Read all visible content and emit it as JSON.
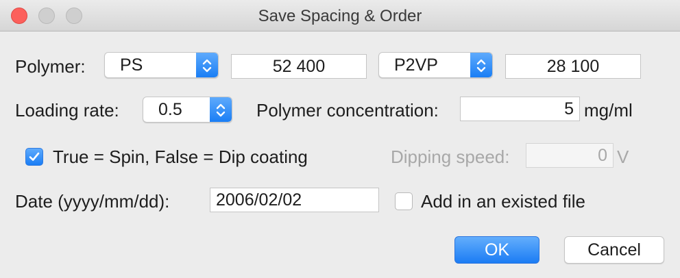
{
  "window": {
    "title": "Save Spacing & Order"
  },
  "polymer": {
    "label": "Polymer:",
    "select1": "PS",
    "value1": "52 400",
    "select2": "P2VP",
    "value2": "28 100"
  },
  "loading": {
    "label": "Loading rate:",
    "value": "0.5"
  },
  "concentration": {
    "label": "Polymer concentration:",
    "value": "5",
    "unit": "mg/ml"
  },
  "coating": {
    "checkbox_label": "True = Spin, False = Dip coating",
    "checked": true,
    "dipping_label": "Dipping speed:",
    "dipping_value": "0",
    "dipping_unit": "V"
  },
  "date": {
    "label": "Date (yyyy/mm/dd):",
    "value": "2006/02/02",
    "add_file_label": "Add in an existed file",
    "add_file_checked": false
  },
  "buttons": {
    "ok": "OK",
    "cancel": "Cancel"
  },
  "colors": {
    "accent": "#1a7ef5",
    "close": "#fc605c"
  }
}
